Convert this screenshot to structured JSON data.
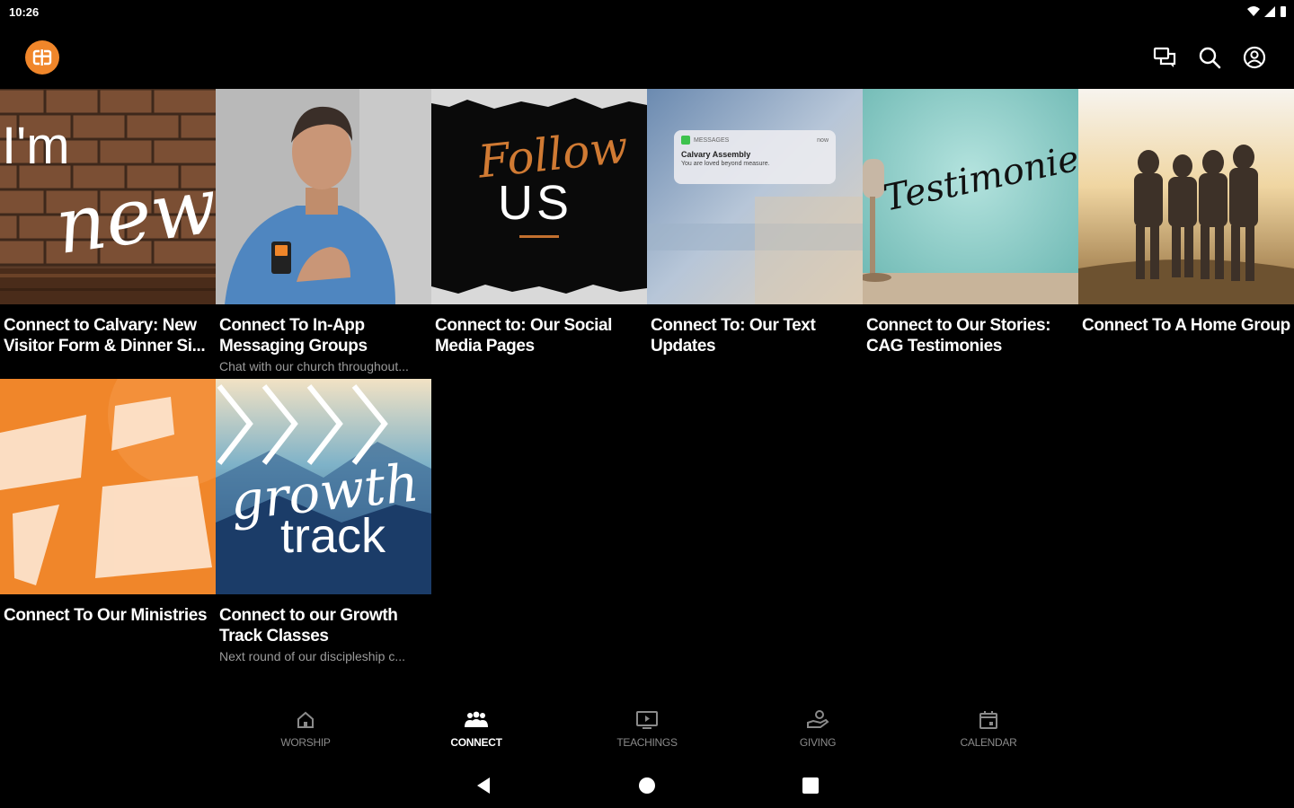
{
  "status": {
    "time": "10:26"
  },
  "appbar": {
    "actions": [
      {
        "name": "messages-icon"
      },
      {
        "name": "search-icon"
      },
      {
        "name": "account-icon"
      }
    ]
  },
  "thumbnails": {
    "new": {
      "line1": "I'm",
      "line2": "new"
    },
    "follow": {
      "script": "Follow",
      "word": "US"
    },
    "text_updates": {
      "app": "MESSAGES",
      "when": "now",
      "sender": "Calvary Assembly",
      "body": "You are loved beyond measure."
    },
    "testimonies": {
      "word": "Testimonies"
    },
    "growth": {
      "line1": "growth",
      "line2": "track"
    }
  },
  "cards": [
    {
      "title": "Connect to Calvary: New Visitor Form & Dinner Si...",
      "subtitle": ""
    },
    {
      "title": "Connect To In-App Messaging Groups",
      "subtitle": "Chat with our church throughout..."
    },
    {
      "title": "Connect to: Our Social Media Pages",
      "subtitle": ""
    },
    {
      "title": "Connect To: Our Text Updates",
      "subtitle": ""
    },
    {
      "title": "Connect to Our Stories: CAG Testimonies",
      "subtitle": ""
    },
    {
      "title": "Connect To A Home Group",
      "subtitle": ""
    },
    {
      "title": "Connect To Our Ministries",
      "subtitle": ""
    },
    {
      "title": "Connect to our Growth Track Classes",
      "subtitle": "Next round of our discipleship c..."
    }
  ],
  "bottom_nav": [
    {
      "label": "WORSHIP",
      "icon": "home-icon",
      "active": false
    },
    {
      "label": "CONNECT",
      "icon": "people-icon",
      "active": true
    },
    {
      "label": "TEACHINGS",
      "icon": "video-icon",
      "active": false
    },
    {
      "label": "GIVING",
      "icon": "giving-hand-icon",
      "active": false
    },
    {
      "label": "CALENDAR",
      "icon": "calendar-icon",
      "active": false
    }
  ],
  "colors": {
    "accent": "#f0862a",
    "background": "#000000",
    "inactive": "#8a8a8a"
  }
}
